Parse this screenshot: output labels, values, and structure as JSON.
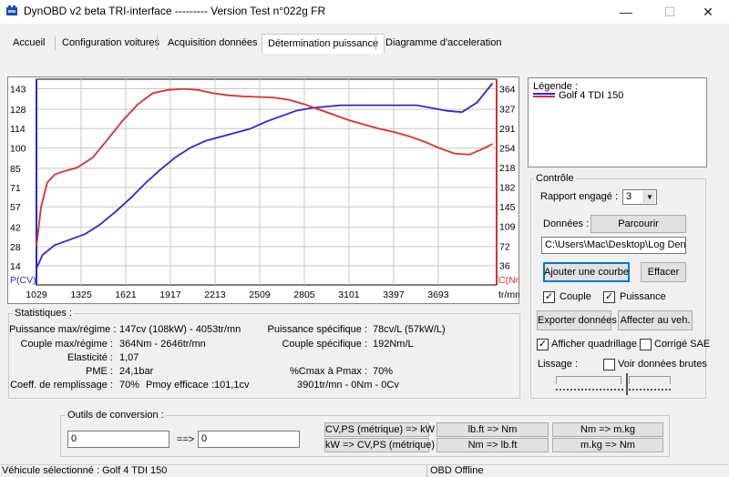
{
  "window": {
    "title": "DynOBD v2 beta TRI-interface --------- Version Test n°022g FR",
    "min_icon": "—",
    "max_icon": "☐",
    "close_icon": "✕"
  },
  "tabs": [
    {
      "label": "Accueil"
    },
    {
      "label": "Configuration voitures"
    },
    {
      "label": "Acquisition données"
    },
    {
      "label": "Détermination puissance"
    },
    {
      "label": "Diagramme d'acceleration"
    }
  ],
  "chart_data": {
    "type": "line",
    "left_axis": {
      "label": "P(CV)",
      "ticks": [
        14,
        28,
        42,
        57,
        71,
        85,
        100,
        114,
        128,
        143
      ],
      "range": [
        0,
        150
      ]
    },
    "right_axis": {
      "label": "C(Nm)",
      "ticks": [
        36,
        72,
        109,
        145,
        182,
        218,
        254,
        291,
        327,
        364
      ],
      "range": [
        0,
        382
      ]
    },
    "x_axis": {
      "label": "tr/mn",
      "ticks": [
        1029,
        1325,
        1621,
        1917,
        2213,
        2509,
        2805,
        3101,
        3397,
        3693
      ],
      "range": [
        1029,
        4080
      ]
    },
    "series": [
      {
        "name": "Puissance",
        "color": "#2a2acc",
        "axis": "left",
        "x": [
          1029,
          1070,
          1150,
          1250,
          1350,
          1450,
          1550,
          1650,
          1750,
          1850,
          1950,
          2050,
          2150,
          2250,
          2350,
          2450,
          2550,
          2650,
          2750,
          2850,
          2950,
          3050,
          3150,
          3250,
          3350,
          3450,
          3550,
          3650,
          3750,
          3850,
          3950,
          4053
        ],
        "values": [
          12,
          22,
          29,
          33,
          37,
          44,
          53,
          63,
          74,
          84,
          93,
          100,
          105,
          108,
          111,
          114,
          119,
          123,
          127,
          129,
          130,
          131,
          131,
          131,
          131,
          131,
          131,
          129,
          127,
          126,
          133,
          147
        ]
      },
      {
        "name": "Couple",
        "color": "#d93030",
        "axis": "right",
        "x": [
          1029,
          1060,
          1100,
          1150,
          1200,
          1300,
          1400,
          1500,
          1600,
          1700,
          1800,
          1900,
          2000,
          2100,
          2200,
          2300,
          2400,
          2500,
          2600,
          2700,
          2800,
          2900,
          3000,
          3100,
          3200,
          3300,
          3400,
          3500,
          3600,
          3700,
          3800,
          3900,
          4000,
          4053
        ],
        "values": [
          72,
          145,
          190,
          205,
          210,
          218,
          236,
          270,
          305,
          335,
          356,
          362,
          364,
          362,
          356,
          352,
          350,
          349,
          348,
          344,
          336,
          326,
          316,
          306,
          298,
          290,
          284,
          276,
          266,
          254,
          244,
          242,
          254,
          262
        ]
      }
    ]
  },
  "legend": {
    "title": "Légende :",
    "entries": [
      {
        "label": "Golf 4 TDI 150",
        "colors": [
          "#2a2acc",
          "#d93030"
        ]
      }
    ]
  },
  "controle": {
    "title": "Contrôle",
    "rapport_label": "Rapport engagé :",
    "rapport_value": "3",
    "donnees_label": "Données :",
    "parcourir": "Parcourir",
    "path": "C:\\Users\\Mac\\Desktop\\Log Deni:",
    "ajouter": "Ajouter une courbe",
    "effacer": "Effacer",
    "couple_label": "Couple",
    "couple_checked": true,
    "puissance_label": "Puissance",
    "puissance_checked": true,
    "exporter": "Exporter données",
    "affecter": "Affecter au veh.",
    "quadrillage_label": "Afficher quadrillage",
    "quadrillage_checked": true,
    "sae_label": "Corrigé SAE",
    "sae_checked": false,
    "lissage_label": "Lissage :",
    "brutes_label": "Voir données brutes",
    "brutes_checked": false
  },
  "stats": {
    "title": "Statistiques :",
    "rows": [
      {
        "label": "Puissance max/régime :",
        "value": "147cv (108kW) - 4053tr/mn"
      },
      {
        "label": "Couple max/régime :",
        "value": "364Nm - 2646tr/mn"
      },
      {
        "label": "Elasticité :",
        "value": "1,07"
      },
      {
        "label": "PME :",
        "value": "24,1bar"
      },
      {
        "label": "Coeff. de remplissage :",
        "value": "70%"
      }
    ],
    "pmoy_label": "Pmoy efficace :",
    "pmoy_value": "101,1cv",
    "right_rows": [
      {
        "label": "Puissance spécifique :",
        "value": "78cv/L (57kW/L)"
      },
      {
        "label": "Couple spécifique :",
        "value": "192Nm/L"
      },
      {
        "label": "%Cmax à Pmax :",
        "value": "70%"
      }
    ],
    "line_extra": "3901tr/mn - 0Nm - 0Cv"
  },
  "outils": {
    "title": "Outils de conversion :",
    "input1": "0",
    "arrow": "==>",
    "input2": "0",
    "btn1": "CV,PS (métrique) => kW",
    "btn2": "kW => CV,PS (métrique)",
    "btn3": "lb.ft => Nm",
    "btn4": "Nm => lb.ft",
    "btn5": "Nm => m.kg",
    "btn6": "m.kg => Nm"
  },
  "status": {
    "vehicle": "Véhicule sélectionné : Golf 4 TDI 150",
    "obd": "OBD Offline"
  }
}
